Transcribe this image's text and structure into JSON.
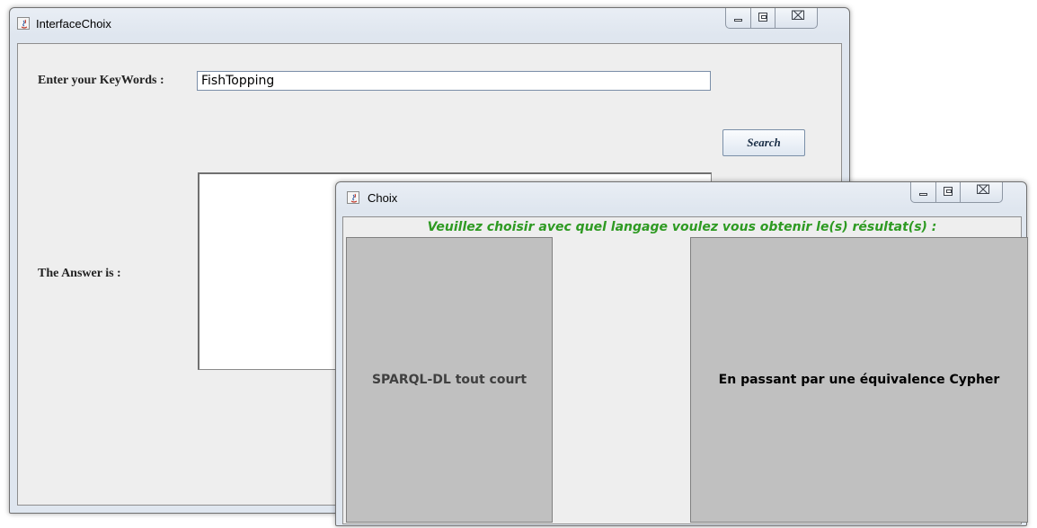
{
  "main_window": {
    "title": "InterfaceChoix",
    "keywords_label": "Enter your KeyWords :",
    "keywords_value": "FishTopping",
    "search_label": "Search",
    "answer_label": "The Answer is :",
    "answer_value": ""
  },
  "dialog": {
    "title": "Choix",
    "prompt": "Veuillez choisir avec quel langage voulez vous obtenir le(s) résultat(s) :",
    "option_sparql": "SPARQL-DL tout court",
    "option_cypher": "En passant par une équivalence Cypher"
  },
  "window_controls": {
    "close_glyph": "⌧"
  },
  "colors": {
    "prompt_green": "#2e9a22",
    "choice_gray": "#c0c0c0",
    "panel_bg": "#eeeeee"
  }
}
